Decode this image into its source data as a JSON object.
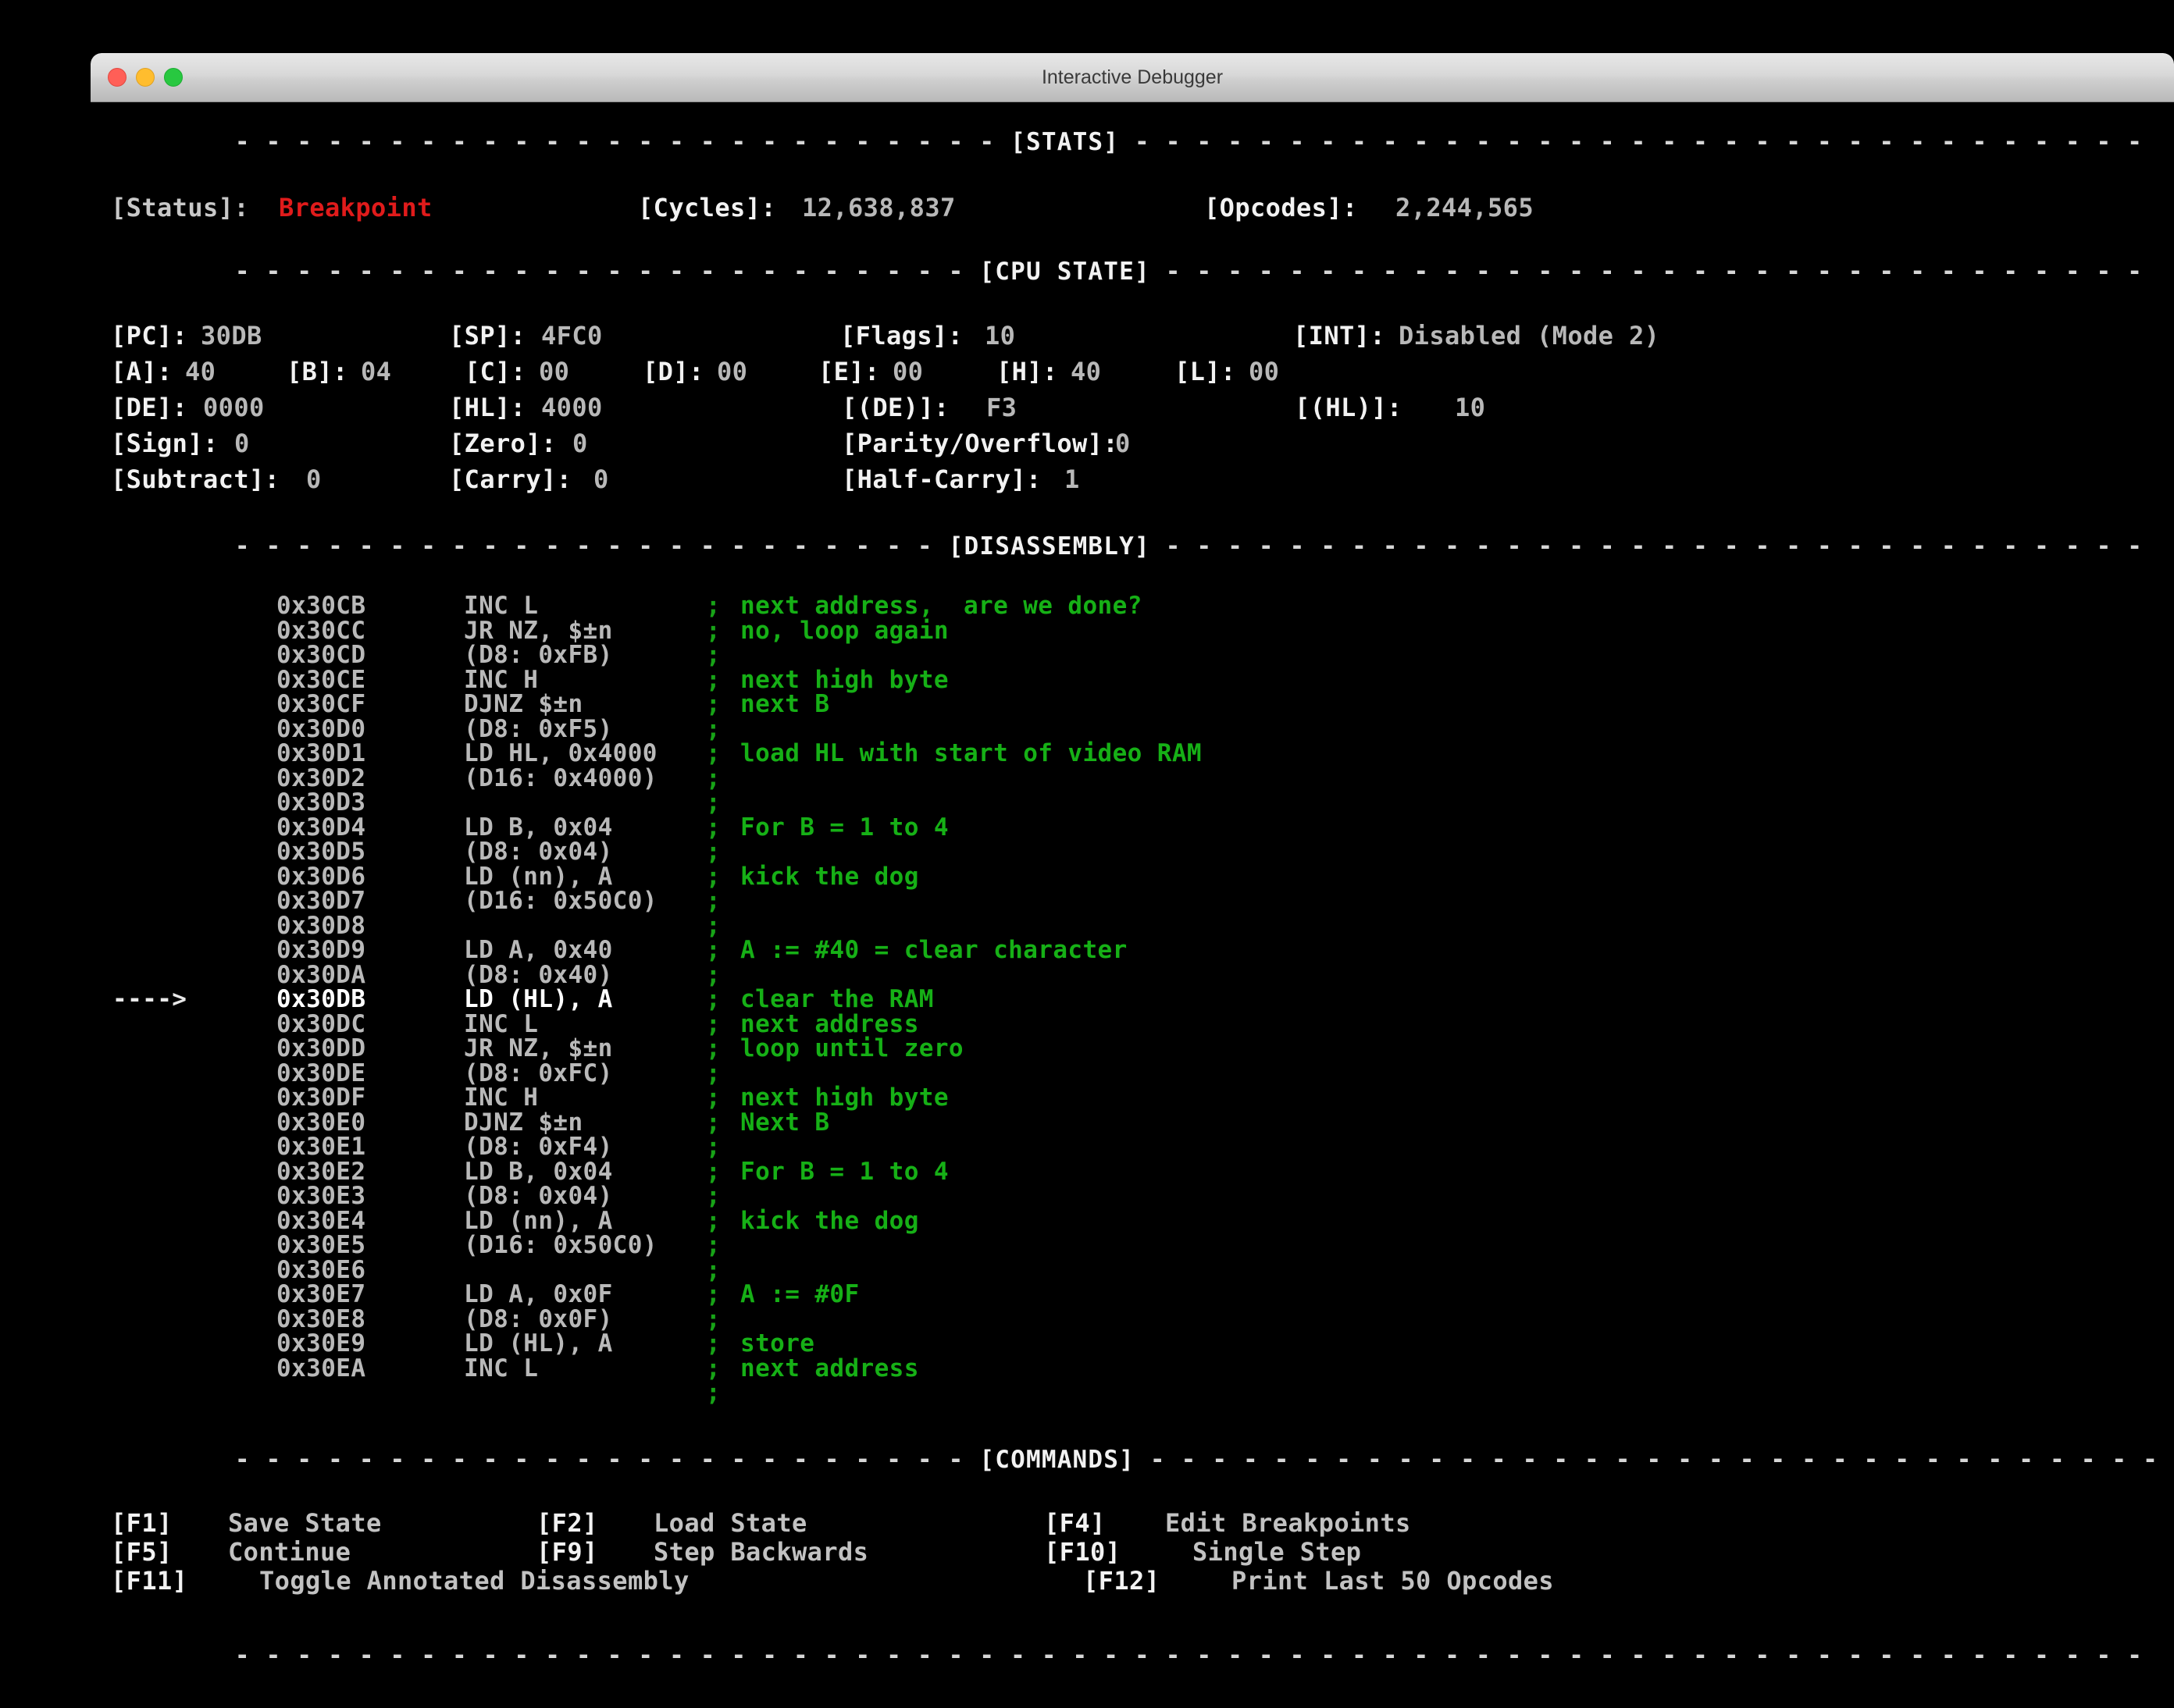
{
  "window": {
    "title": "Interactive Debugger",
    "traffic_lights": [
      "close-button",
      "minimize-button",
      "zoom-button"
    ]
  },
  "colors": {
    "background": "#000000",
    "foreground": "#c8c8c8",
    "status_alert": "#e01b1b",
    "comment_green": "#16b016",
    "current_line": "#ffffff"
  },
  "sections": {
    "stats_header": "[STATS]",
    "cpu_header": "[CPU STATE]",
    "disassembly_header": "[DISASSEMBLY]",
    "commands_header": "[COMMANDS]"
  },
  "stats": {
    "status_label": "[Status]:",
    "status_value": "Breakpoint",
    "cycles_label": "[Cycles]:",
    "cycles_value": "12,638,837",
    "opcodes_label": "[Opcodes]:",
    "opcodes_value": "2,244,565"
  },
  "cpu": {
    "row1": [
      {
        "label": "[PC]:",
        "value": "30DB"
      },
      {
        "label": "[SP]:",
        "value": "4FC0"
      },
      {
        "label": "[Flags]:",
        "value": "10"
      },
      {
        "label": "[INT]:",
        "value": "Disabled (Mode 2)"
      }
    ],
    "row2": [
      {
        "label": "[A]:",
        "value": "40"
      },
      {
        "label": "[B]:",
        "value": "04"
      },
      {
        "label": "[C]:",
        "value": "00"
      },
      {
        "label": "[D]:",
        "value": "00"
      },
      {
        "label": "[E]:",
        "value": "00"
      },
      {
        "label": "[H]:",
        "value": "40"
      },
      {
        "label": "[L]:",
        "value": "00"
      }
    ],
    "row3": [
      {
        "label": "[DE]:",
        "value": "0000"
      },
      {
        "label": "[HL]:",
        "value": "4000"
      },
      {
        "label": "[(DE)]:",
        "value": "F3"
      },
      {
        "label": "[(HL)]:",
        "value": "10"
      }
    ],
    "row4": [
      {
        "label": "[Sign]:",
        "value": "0"
      },
      {
        "label": "[Zero]:",
        "value": "0"
      },
      {
        "label": "[Parity/Overflow]:",
        "value": "0"
      }
    ],
    "row5": [
      {
        "label": "[Subtract]:",
        "value": "0"
      },
      {
        "label": "[Carry]:",
        "value": "0"
      },
      {
        "label": "[Half-Carry]:",
        "value": "1"
      }
    ]
  },
  "disassembly": {
    "current_marker": "---->",
    "comment_prefix": ";",
    "lines": [
      {
        "marker": "",
        "address": "0x30CB",
        "opcode": "INC L",
        "comment": "next address,  are we done?",
        "current": false
      },
      {
        "marker": "",
        "address": "0x30CC",
        "opcode": "JR NZ, $±n",
        "comment": "no, loop again",
        "current": false
      },
      {
        "marker": "",
        "address": "0x30CD",
        "opcode": "(D8: 0xFB)",
        "comment": "",
        "current": false
      },
      {
        "marker": "",
        "address": "0x30CE",
        "opcode": "INC H",
        "comment": "next high byte",
        "current": false
      },
      {
        "marker": "",
        "address": "0x30CF",
        "opcode": "DJNZ $±n",
        "comment": "next B",
        "current": false
      },
      {
        "marker": "",
        "address": "0x30D0",
        "opcode": "(D8: 0xF5)",
        "comment": "",
        "current": false
      },
      {
        "marker": "",
        "address": "0x30D1",
        "opcode": "LD HL, 0x4000",
        "comment": "load HL with start of video RAM",
        "current": false
      },
      {
        "marker": "",
        "address": "0x30D2",
        "opcode": "(D16: 0x4000)",
        "comment": "",
        "current": false
      },
      {
        "marker": "",
        "address": "0x30D3",
        "opcode": "",
        "comment": "",
        "current": false
      },
      {
        "marker": "",
        "address": "0x30D4",
        "opcode": "LD B, 0x04",
        "comment": "For B = 1 to 4",
        "current": false
      },
      {
        "marker": "",
        "address": "0x30D5",
        "opcode": "(D8: 0x04)",
        "comment": "",
        "current": false
      },
      {
        "marker": "",
        "address": "0x30D6",
        "opcode": "LD (nn), A",
        "comment": "kick the dog",
        "current": false
      },
      {
        "marker": "",
        "address": "0x30D7",
        "opcode": "(D16: 0x50C0)",
        "comment": "",
        "current": false
      },
      {
        "marker": "",
        "address": "0x30D8",
        "opcode": "",
        "comment": "",
        "current": false
      },
      {
        "marker": "",
        "address": "0x30D9",
        "opcode": "LD A, 0x40",
        "comment": "A := #40 = clear character",
        "current": false
      },
      {
        "marker": "",
        "address": "0x30DA",
        "opcode": "(D8: 0x40)",
        "comment": "",
        "current": false
      },
      {
        "marker": "---->",
        "address": "0x30DB",
        "opcode": "LD (HL), A",
        "comment": "clear the RAM",
        "current": true
      },
      {
        "marker": "",
        "address": "0x30DC",
        "opcode": "INC L",
        "comment": "next address",
        "current": false
      },
      {
        "marker": "",
        "address": "0x30DD",
        "opcode": "JR NZ, $±n",
        "comment": "loop until zero",
        "current": false
      },
      {
        "marker": "",
        "address": "0x30DE",
        "opcode": "(D8: 0xFC)",
        "comment": "",
        "current": false
      },
      {
        "marker": "",
        "address": "0x30DF",
        "opcode": "INC H",
        "comment": "next high byte",
        "current": false
      },
      {
        "marker": "",
        "address": "0x30E0",
        "opcode": "DJNZ $±n",
        "comment": "Next B",
        "current": false
      },
      {
        "marker": "",
        "address": "0x30E1",
        "opcode": "(D8: 0xF4)",
        "comment": "",
        "current": false
      },
      {
        "marker": "",
        "address": "0x30E2",
        "opcode": "LD B, 0x04",
        "comment": "For B = 1 to 4",
        "current": false
      },
      {
        "marker": "",
        "address": "0x30E3",
        "opcode": "(D8: 0x04)",
        "comment": "",
        "current": false
      },
      {
        "marker": "",
        "address": "0x30E4",
        "opcode": "LD (nn), A",
        "comment": "kick the dog",
        "current": false
      },
      {
        "marker": "",
        "address": "0x30E5",
        "opcode": "(D16: 0x50C0)",
        "comment": "",
        "current": false
      },
      {
        "marker": "",
        "address": "0x30E6",
        "opcode": "",
        "comment": "",
        "current": false
      },
      {
        "marker": "",
        "address": "0x30E7",
        "opcode": "LD A, 0x0F",
        "comment": "A := #0F",
        "current": false
      },
      {
        "marker": "",
        "address": "0x30E8",
        "opcode": "(D8: 0x0F)",
        "comment": "",
        "current": false
      },
      {
        "marker": "",
        "address": "0x30E9",
        "opcode": "LD (HL), A",
        "comment": "store",
        "current": false
      },
      {
        "marker": "",
        "address": "0x30EA",
        "opcode": "INC L",
        "comment": "next address",
        "current": false
      },
      {
        "marker": "",
        "address": "",
        "opcode": "",
        "comment": "",
        "current": false
      }
    ]
  },
  "commands": {
    "rows": [
      [
        {
          "key": "[F1]",
          "label": "Save State"
        },
        {
          "key": "[F2]",
          "label": "Load State"
        },
        {
          "key": "[F4]",
          "label": "Edit Breakpoints"
        }
      ],
      [
        {
          "key": "[F5]",
          "label": "Continue"
        },
        {
          "key": "[F9]",
          "label": "Step Backwards"
        },
        {
          "key": "[F10]",
          "label": "Single Step"
        }
      ],
      [
        {
          "key": "[F11]",
          "label": "Toggle Annotated Disassembly"
        },
        {
          "key": "[F12]",
          "label": "Print Last 50 Opcodes"
        }
      ]
    ]
  }
}
